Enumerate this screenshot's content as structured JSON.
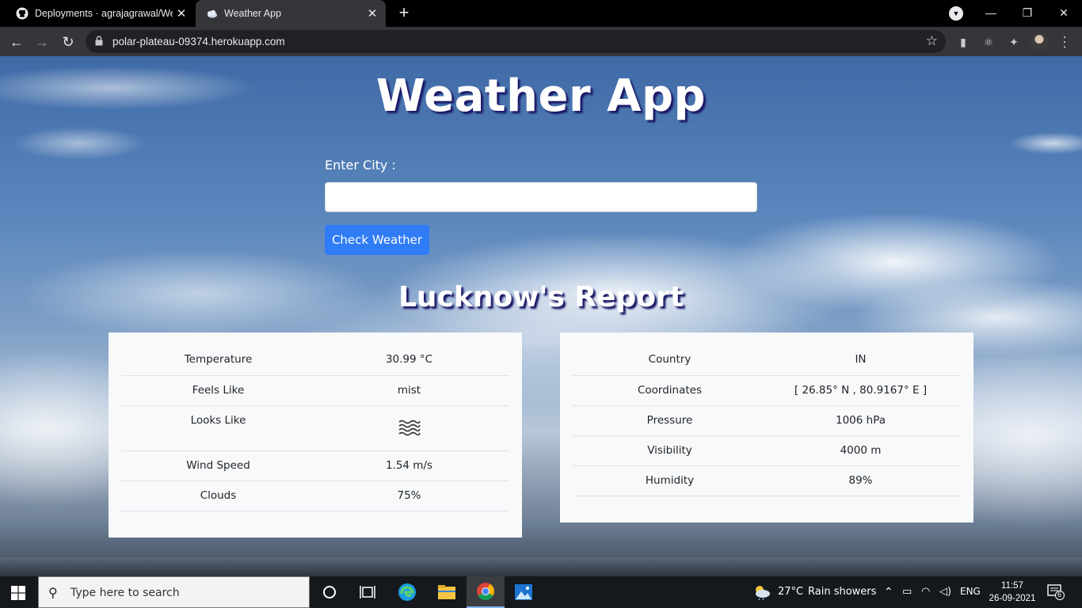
{
  "browser": {
    "tabs": [
      {
        "title": "Deployments · agrajagrawal/Wea",
        "active": false,
        "icon": "github-icon"
      },
      {
        "title": "Weather App",
        "active": true,
        "icon": "weather-favicon-icon"
      }
    ],
    "url": "polar-plateau-09374.herokuapp.com"
  },
  "page": {
    "title": "Weather App",
    "city_label": "Enter City :",
    "city_value": "",
    "check_button": "Check Weather",
    "report_title": "Lucknow's Report",
    "left_table": [
      {
        "label": "Temperature",
        "value": "30.99 °C"
      },
      {
        "label": "Feels Like",
        "value": "mist"
      },
      {
        "label": "Looks Like",
        "value": "",
        "icon": "mist-icon"
      },
      {
        "label": "Wind Speed",
        "value": "1.54 m/s"
      },
      {
        "label": "Clouds",
        "value": "75%"
      }
    ],
    "right_table": [
      {
        "label": "Country",
        "value": "IN"
      },
      {
        "label": "Coordinates",
        "value": "[ 26.85° N , 80.9167° E ]"
      },
      {
        "label": "Pressure",
        "value": "1006 hPa"
      },
      {
        "label": "Visibility",
        "value": "4000 m"
      },
      {
        "label": "Humidity",
        "value": "89%"
      }
    ],
    "colors": {
      "button": "#2f7cf6",
      "title_shadow": "#1a1766",
      "card": "#f8f9fa"
    }
  },
  "taskbar": {
    "search_placeholder": "Type here to search",
    "weather_temp": "27°C",
    "weather_text": "Rain showers",
    "language": "ENG",
    "time": "11:57",
    "date": "26-09-2021",
    "notification_count": "6"
  }
}
